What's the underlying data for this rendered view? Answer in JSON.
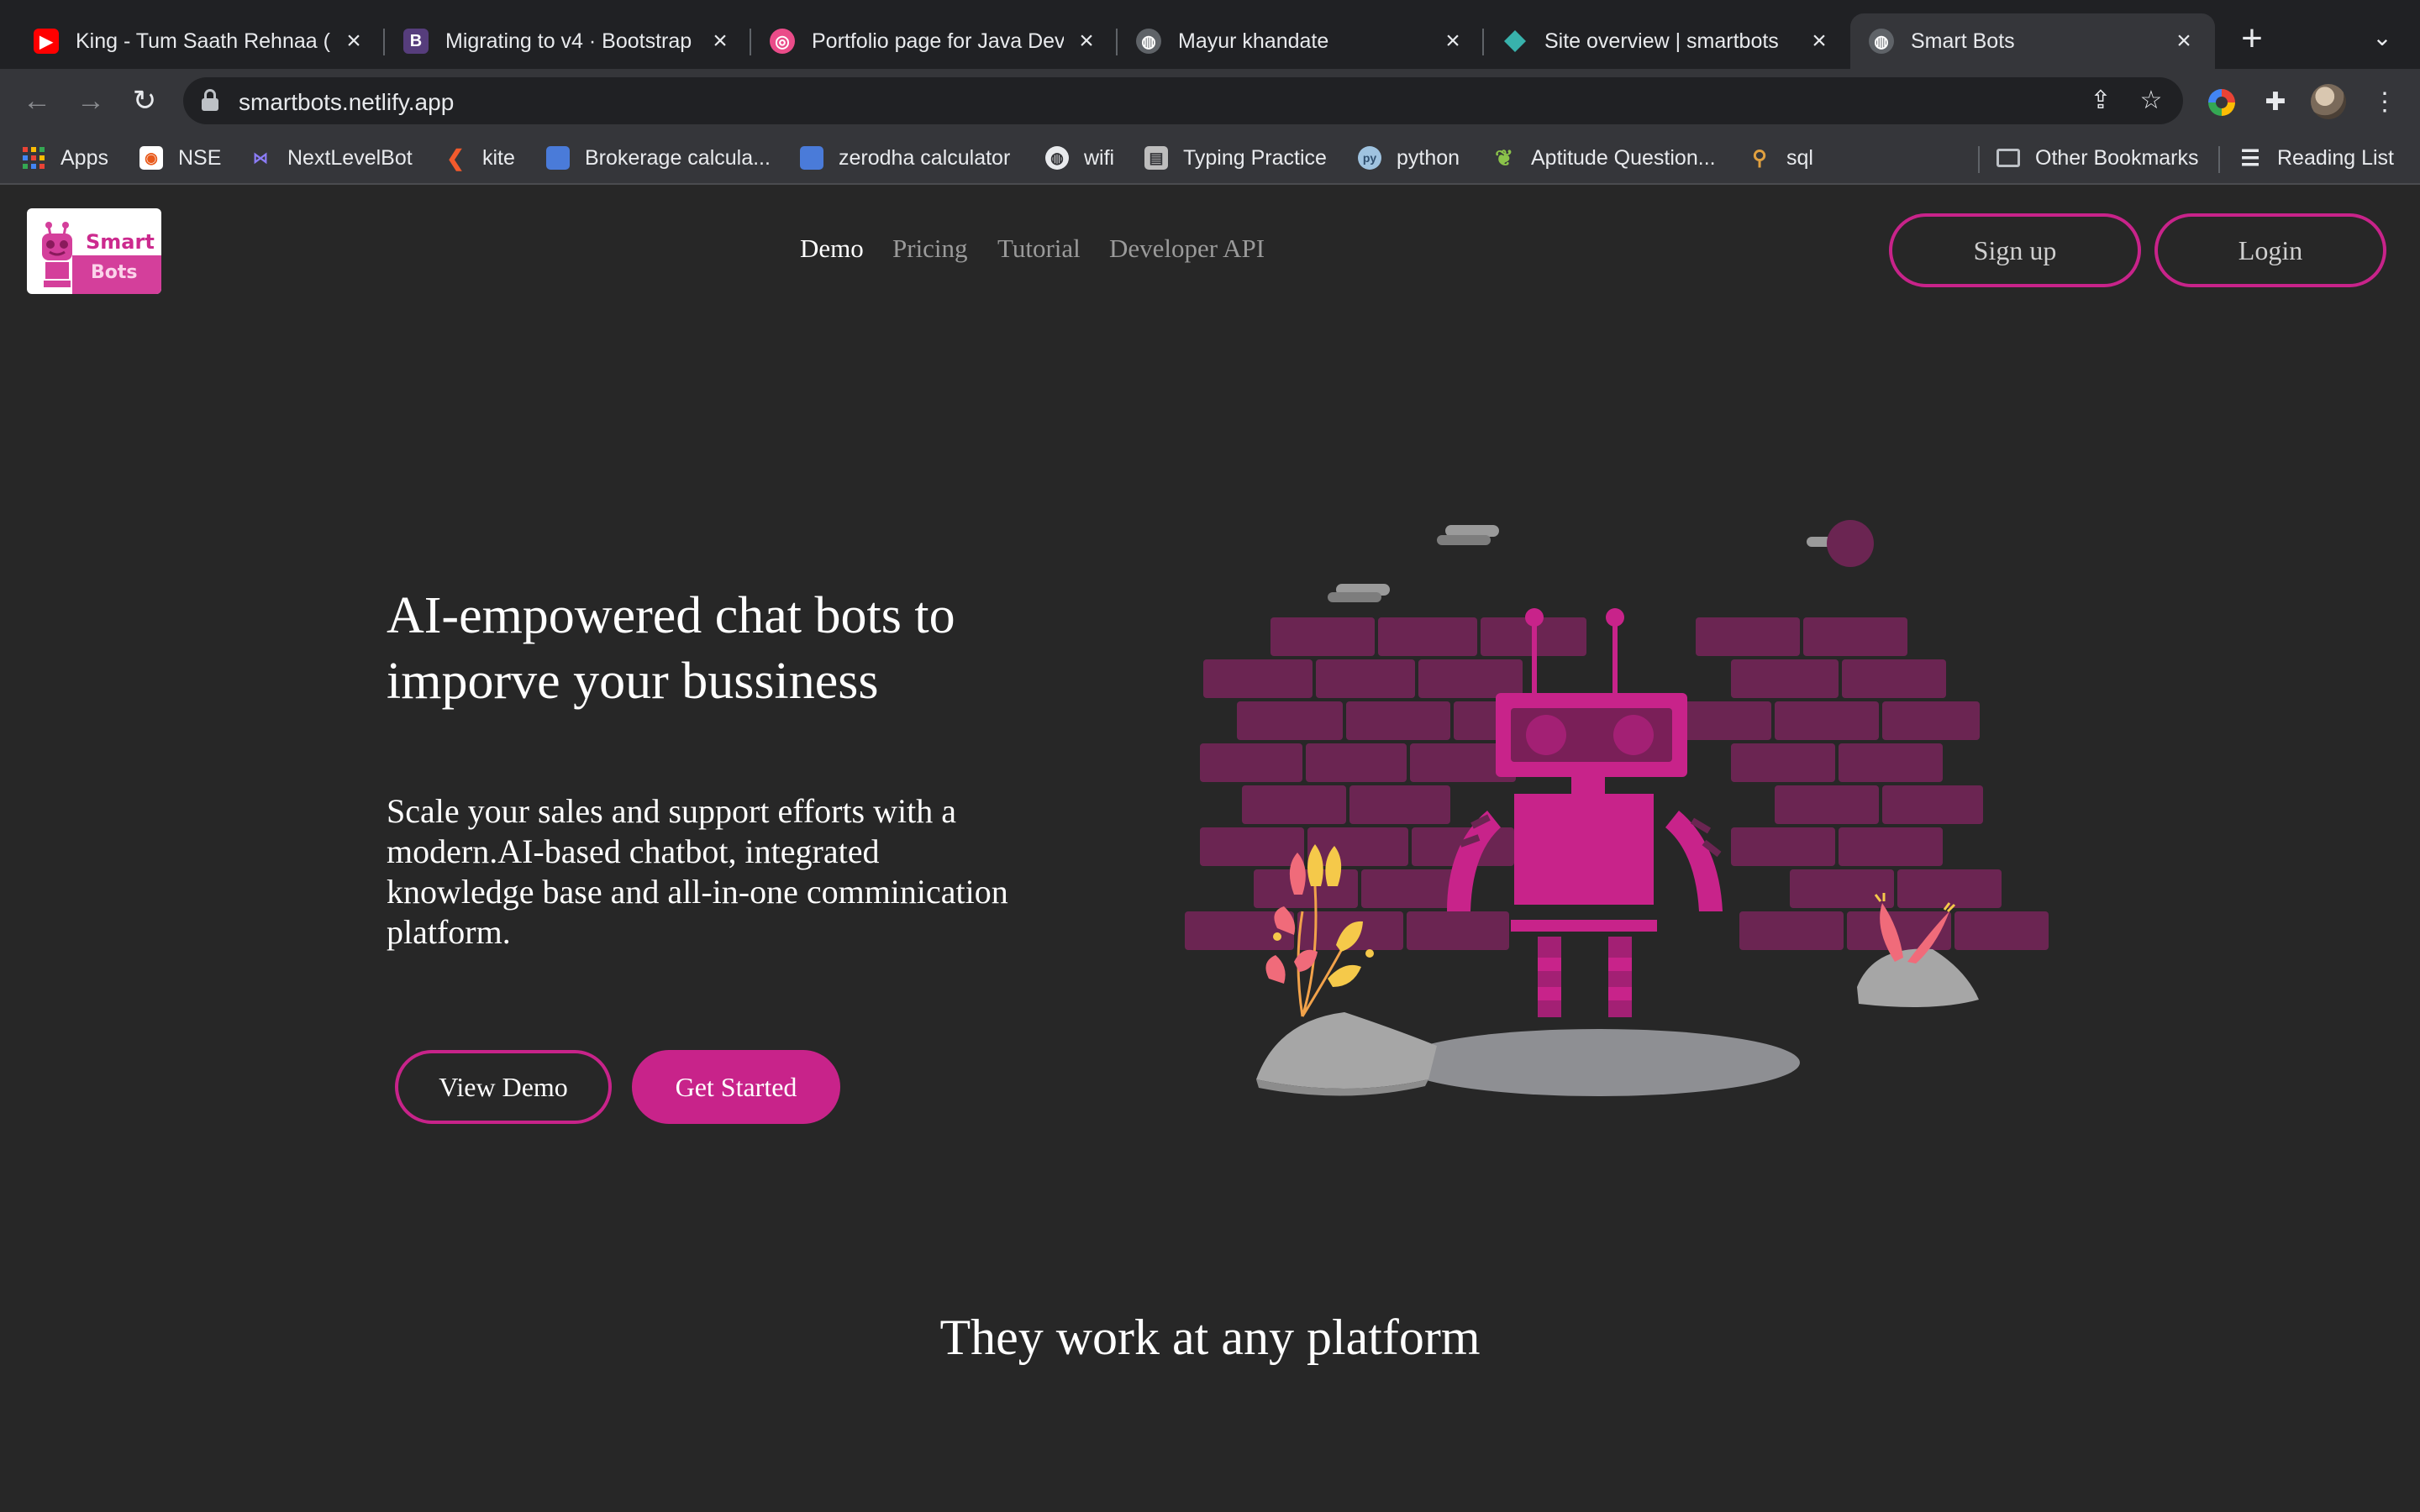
{
  "browser": {
    "tabs": [
      {
        "title": "King - Tum Saath Rehnaa (C",
        "favicon": "youtube-icon",
        "color": "#ff0000"
      },
      {
        "title": "Migrating to v4 · Bootstrap",
        "favicon": "bootstrap-icon",
        "color": "#563d7c"
      },
      {
        "title": "Portfolio page for Java Dev",
        "favicon": "dribbble-icon",
        "color": "#ea4c89"
      },
      {
        "title": "Mayur khandate",
        "favicon": "globe-icon",
        "color": "#5f6368"
      },
      {
        "title": "Site overview | smartbots",
        "favicon": "netlify-icon",
        "color": "#38b2ac"
      },
      {
        "title": "Smart Bots",
        "favicon": "globe-icon",
        "color": "#5f6368"
      }
    ],
    "url": "smartbots.netlify.app",
    "bookmarks": [
      {
        "label": "Apps",
        "icon": "apps-grid-icon"
      },
      {
        "label": "NSE",
        "icon": "nse-icon"
      },
      {
        "label": "NextLevelBot",
        "icon": "nextlevelbot-icon"
      },
      {
        "label": "kite",
        "icon": "kite-icon"
      },
      {
        "label": "Brokerage calcula...",
        "icon": "document-icon"
      },
      {
        "label": "zerodha calculator",
        "icon": "document-icon"
      },
      {
        "label": "wifi",
        "icon": "globe-icon"
      },
      {
        "label": "Typing Practice",
        "icon": "typing-icon"
      },
      {
        "label": "python",
        "icon": "python-icon"
      },
      {
        "label": "Aptitude Question...",
        "icon": "leaf-icon"
      },
      {
        "label": "sql",
        "icon": "sql-icon"
      }
    ],
    "other_bookmarks": "Other Bookmarks",
    "reading_list": "Reading List"
  },
  "site": {
    "logo": {
      "line1": "Smart",
      "line2": "Bots"
    },
    "nav": [
      "Demo",
      "Pricing",
      "Tutorial",
      "Developer API"
    ],
    "signup": "Sign up",
    "login": "Login",
    "hero": {
      "title": "AI-empowered chat bots to imporve your bussiness",
      "subtitle": "Scale your sales and support efforts with a modern.AI-based chatbot, integrated knowledge base and all-in-one comminication platform.",
      "view_demo": "View Demo",
      "get_started": "Get Started"
    },
    "section_title": "They work at any platform",
    "colors": {
      "accent": "#c8238a",
      "background": "#272727",
      "brick": "#6b2552"
    }
  }
}
